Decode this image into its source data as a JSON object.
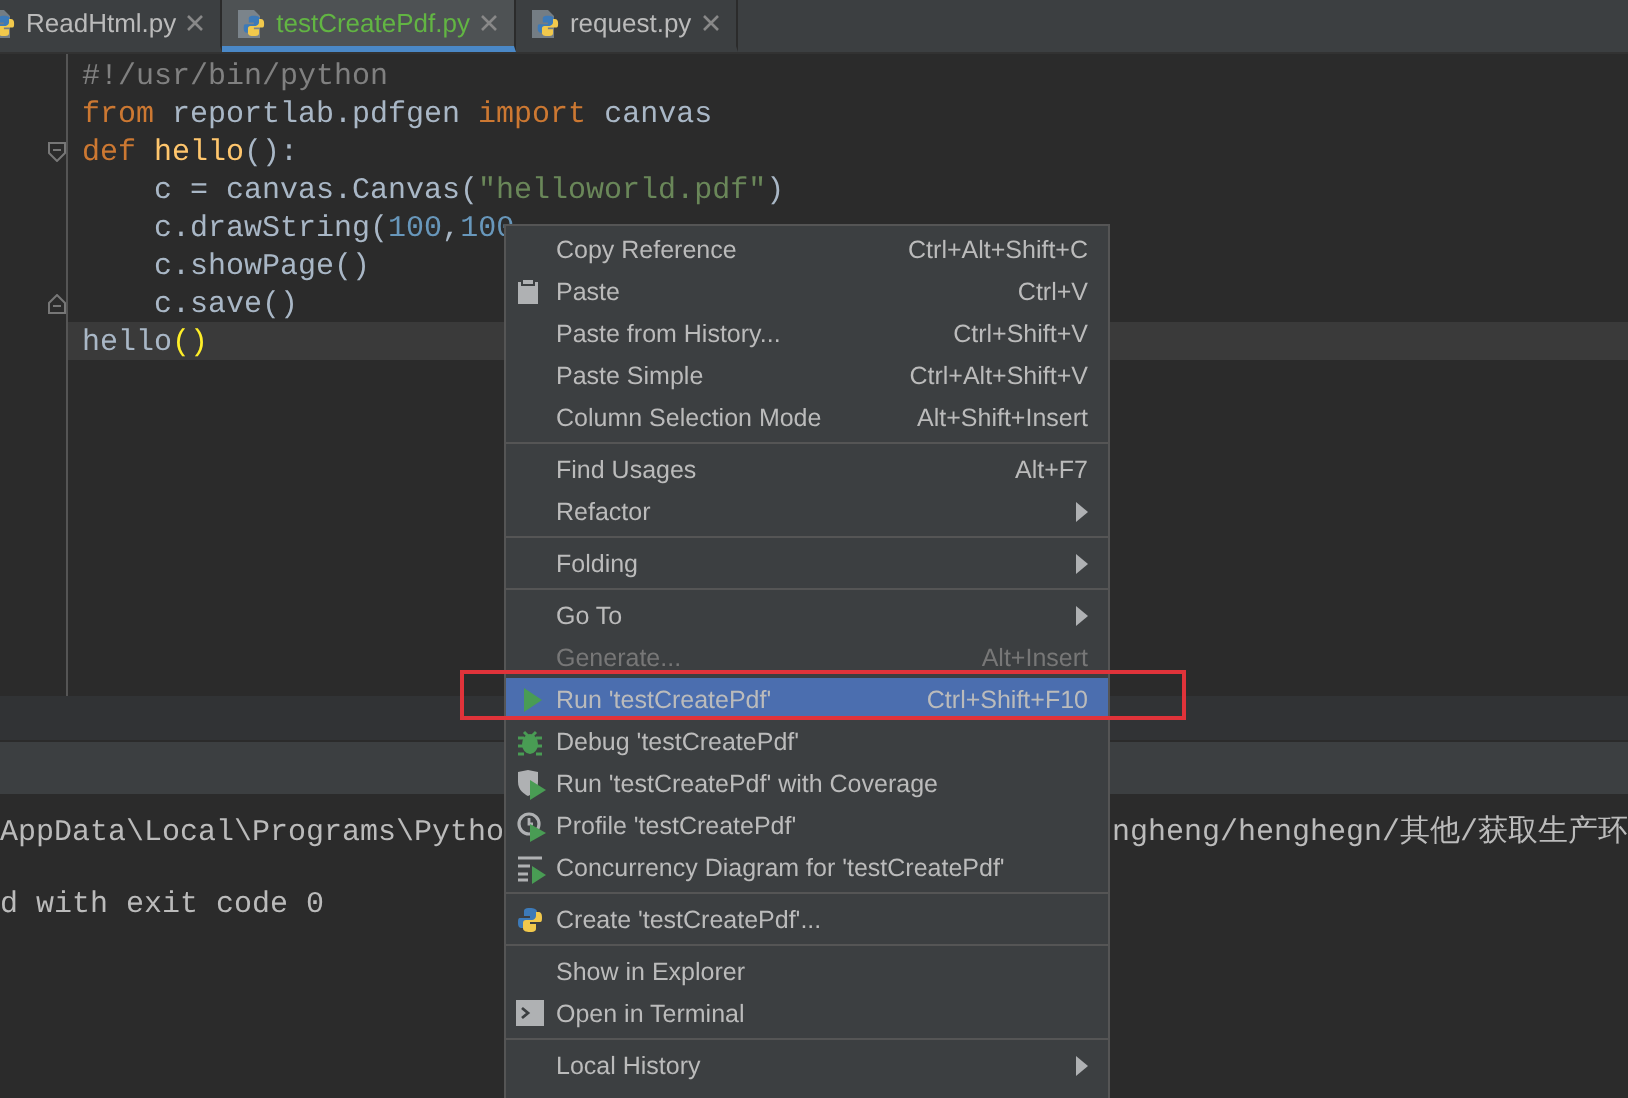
{
  "tabs": [
    {
      "label": "ReadHtml.py",
      "selected": false
    },
    {
      "label": "testCreatePdf.py",
      "selected": true
    },
    {
      "label": "request.py",
      "selected": false
    }
  ],
  "code_lines": [
    {
      "current": false,
      "tokens": [
        {
          "text": "#!/usr/bin/python",
          "kind": "comment"
        }
      ]
    },
    {
      "current": false,
      "tokens": [
        {
          "text": "from",
          "kind": "keyword"
        },
        {
          "text": " reportlab.pdfgen ",
          "kind": "plain"
        },
        {
          "text": "import",
          "kind": "keyword"
        },
        {
          "text": " canvas",
          "kind": "plain"
        }
      ]
    },
    {
      "current": false,
      "tokens": [
        {
          "text": "def",
          "kind": "keyword"
        },
        {
          "text": " hello",
          "kind": "function"
        },
        {
          "text": "():",
          "kind": "plain"
        }
      ]
    },
    {
      "current": false,
      "tokens": [
        {
          "text": "    c = canvas.Canvas(",
          "kind": "plain"
        },
        {
          "text": "\"helloworld.pdf\"",
          "kind": "string"
        },
        {
          "text": ")",
          "kind": "plain"
        }
      ]
    },
    {
      "current": false,
      "tokens": [
        {
          "text": "    c.drawString(",
          "kind": "plain"
        },
        {
          "text": "100",
          "kind": "number"
        },
        {
          "text": ",",
          "kind": "plain"
        },
        {
          "text": "100",
          "kind": "number"
        }
      ]
    },
    {
      "current": false,
      "tokens": [
        {
          "text": "    c.showPage()",
          "kind": "plain"
        }
      ]
    },
    {
      "current": false,
      "tokens": [
        {
          "text": "    c.save()",
          "kind": "plain"
        }
      ]
    },
    {
      "current": true,
      "tokens": [
        {
          "text": "hello",
          "kind": "plain"
        },
        {
          "text": "()",
          "kind": "brace"
        }
      ]
    }
  ],
  "console_lines": [
    {
      "left": "AppData\\Local\\Programs\\Pytho",
      "right": "ngheng/henghegn/其他/获取生产环"
    },
    {
      "left": "d with exit code 0"
    }
  ],
  "context_menu": [
    {
      "kind": "item",
      "label": "Copy Reference",
      "shortcut": "Ctrl+Alt+Shift+C",
      "submenu": false,
      "disabled": false,
      "selected": false
    },
    {
      "kind": "item",
      "label": "Paste",
      "shortcut": "Ctrl+V",
      "submenu": false,
      "disabled": false,
      "selected": false
    },
    {
      "kind": "item",
      "label": "Paste from History...",
      "shortcut": "Ctrl+Shift+V",
      "submenu": false,
      "disabled": false,
      "selected": false
    },
    {
      "kind": "item",
      "label": "Paste Simple",
      "shortcut": "Ctrl+Alt+Shift+V",
      "submenu": false,
      "disabled": false,
      "selected": false
    },
    {
      "kind": "item",
      "label": "Column Selection Mode",
      "shortcut": "Alt+Shift+Insert",
      "submenu": false,
      "disabled": false,
      "selected": false
    },
    {
      "kind": "separator"
    },
    {
      "kind": "item",
      "label": "Find Usages",
      "shortcut": "Alt+F7",
      "submenu": false,
      "disabled": false,
      "selected": false
    },
    {
      "kind": "item",
      "label": "Refactor",
      "submenu": true,
      "disabled": false,
      "selected": false
    },
    {
      "kind": "separator"
    },
    {
      "kind": "item",
      "label": "Folding",
      "submenu": true,
      "disabled": false,
      "selected": false
    },
    {
      "kind": "separator"
    },
    {
      "kind": "item",
      "label": "Go To",
      "submenu": true,
      "disabled": false,
      "selected": false
    },
    {
      "kind": "item",
      "label": "Generate...",
      "shortcut": "Alt+Insert",
      "submenu": false,
      "disabled": true,
      "selected": false
    },
    {
      "kind": "item",
      "label": "Run 'testCreatePdf'",
      "shortcut": "Ctrl+Shift+F10",
      "submenu": false,
      "disabled": false,
      "selected": true
    },
    {
      "kind": "item",
      "label": "Debug 'testCreatePdf'",
      "submenu": false,
      "disabled": false,
      "selected": false
    },
    {
      "kind": "item",
      "label": "Run 'testCreatePdf' with Coverage",
      "submenu": false,
      "disabled": false,
      "selected": false
    },
    {
      "kind": "item",
      "label": "Profile 'testCreatePdf'",
      "submenu": false,
      "disabled": false,
      "selected": false
    },
    {
      "kind": "item",
      "label": "Concurrency Diagram for 'testCreatePdf'",
      "submenu": false,
      "disabled": false,
      "selected": false
    },
    {
      "kind": "separator"
    },
    {
      "kind": "item",
      "label": "Create 'testCreatePdf'...",
      "submenu": false,
      "disabled": false,
      "selected": false
    },
    {
      "kind": "separator"
    },
    {
      "kind": "item",
      "label": "Show in Explorer",
      "submenu": false,
      "disabled": false,
      "selected": false
    },
    {
      "kind": "item",
      "label": "Open in Terminal",
      "submenu": false,
      "disabled": false,
      "selected": false
    },
    {
      "kind": "separator"
    },
    {
      "kind": "item",
      "label": "Local History",
      "submenu": true,
      "disabled": false,
      "selected": false
    }
  ]
}
